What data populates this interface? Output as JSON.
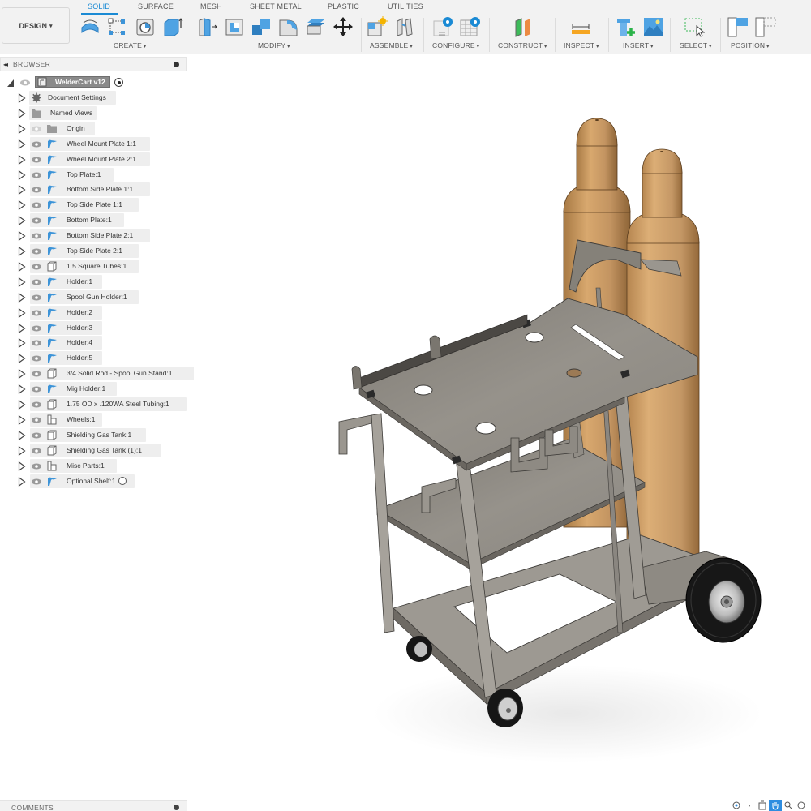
{
  "workspace": {
    "label": "DESIGN"
  },
  "tabs": [
    {
      "label": "SOLID",
      "active": true
    },
    {
      "label": "SURFACE",
      "active": false
    },
    {
      "label": "MESH",
      "active": false
    },
    {
      "label": "SHEET METAL",
      "active": false
    },
    {
      "label": "PLASTIC",
      "active": false
    },
    {
      "label": "UTILITIES",
      "active": false
    }
  ],
  "toolbar_groups": [
    {
      "label": "CREATE",
      "icons": [
        "revolve-icon",
        "sketch-icon",
        "hole-icon",
        "extrude-icon"
      ]
    },
    {
      "label": "MODIFY",
      "icons": [
        "press-pull-icon",
        "shell-icon",
        "combine-icon",
        "fillet-icon",
        "offset-face-icon",
        "move-icon"
      ]
    },
    {
      "label": "ASSEMBLE",
      "icons": [
        "new-component-icon",
        "joint-icon"
      ]
    },
    {
      "label": "CONFIGURE",
      "icons": [
        "configure-icon",
        "configure-table-icon"
      ]
    },
    {
      "label": "CONSTRUCT",
      "icons": [
        "offset-plane-icon"
      ]
    },
    {
      "label": "INSPECT",
      "icons": [
        "measure-icon"
      ]
    },
    {
      "label": "INSERT",
      "icons": [
        "insert-mcmaster-icon",
        "insert-canvas-icon"
      ]
    },
    {
      "label": "SELECT",
      "icons": [
        "select-window-icon"
      ]
    },
    {
      "label": "POSITION",
      "icons": [
        "capture-position-icon",
        "revert-position-icon"
      ]
    }
  ],
  "browser": {
    "title": "BROWSER",
    "root": {
      "label": "WelderCart v12"
    },
    "items": [
      {
        "label": "Document Settings",
        "icon": "gear",
        "eye": false
      },
      {
        "label": "Named Views",
        "icon": "folder",
        "eye": false
      },
      {
        "label": "Origin",
        "icon": "folder",
        "eye": "hidden"
      },
      {
        "label": "Wheel Mount Plate 1:1",
        "icon": "sheet",
        "eye": true
      },
      {
        "label": "Wheel Mount Plate 2:1",
        "icon": "sheet",
        "eye": true
      },
      {
        "label": "Top Plate:1",
        "icon": "sheet",
        "eye": true
      },
      {
        "label": "Bottom Side Plate 1:1",
        "icon": "sheet",
        "eye": true
      },
      {
        "label": "Top Side Plate 1:1",
        "icon": "sheet",
        "eye": true
      },
      {
        "label": "Bottom Plate:1",
        "icon": "sheet",
        "eye": true
      },
      {
        "label": "Bottom Side Plate 2:1",
        "icon": "sheet",
        "eye": true
      },
      {
        "label": "Top Side Plate 2:1",
        "icon": "sheet",
        "eye": true
      },
      {
        "label": "1.5 Square Tubes:1",
        "icon": "body",
        "eye": true
      },
      {
        "label": "Holder:1",
        "icon": "sheet",
        "eye": true
      },
      {
        "label": "Spool Gun Holder:1",
        "icon": "sheet",
        "eye": true
      },
      {
        "label": "Holder:2",
        "icon": "sheet",
        "eye": true
      },
      {
        "label": "Holder:3",
        "icon": "sheet",
        "eye": true
      },
      {
        "label": "Holder:4",
        "icon": "sheet",
        "eye": true
      },
      {
        "label": "Holder:5",
        "icon": "sheet",
        "eye": true
      },
      {
        "label": "3/4 Solid Rod - Spool Gun Stand:1",
        "icon": "body",
        "eye": true
      },
      {
        "label": "Mig Holder:1",
        "icon": "sheet",
        "eye": true
      },
      {
        "label": "1.75 OD x .120WA Steel Tubing:1",
        "icon": "body",
        "eye": true
      },
      {
        "label": "Wheels:1",
        "icon": "assembly",
        "eye": true
      },
      {
        "label": "Shielding Gas Tank:1",
        "icon": "body",
        "eye": true
      },
      {
        "label": "Shielding Gas Tank (1):1",
        "icon": "body",
        "eye": true
      },
      {
        "label": "Misc Parts:1",
        "icon": "assembly",
        "eye": true
      },
      {
        "label": "Optional Shelf:1",
        "icon": "sheet",
        "eye": true,
        "radio": true
      }
    ]
  },
  "comments": {
    "title": "COMMENTS"
  },
  "navbar": {
    "buttons": [
      {
        "name": "orbit-icon",
        "active": false
      },
      {
        "name": "look-at-icon",
        "active": false
      },
      {
        "name": "pan-icon",
        "active": true
      },
      {
        "name": "zoom-icon",
        "active": false
      },
      {
        "name": "fit-icon",
        "active": false
      }
    ]
  },
  "colors": {
    "accent": "#1a8ad4",
    "tank": "#c89a63",
    "steel": "#8d8a84",
    "tire": "#1a1a1a"
  }
}
